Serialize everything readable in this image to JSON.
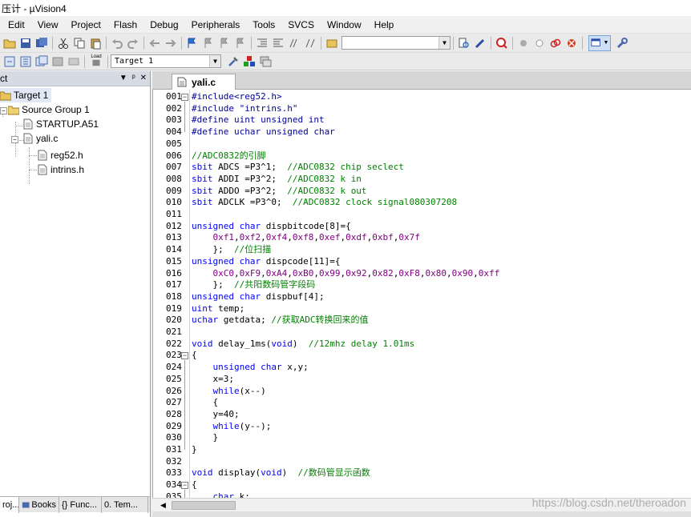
{
  "window": {
    "title": "压计 - µVision4"
  },
  "menu": [
    "Edit",
    "View",
    "Project",
    "Flash",
    "Debug",
    "Peripherals",
    "Tools",
    "SVCS",
    "Window",
    "Help"
  ],
  "toolbar": {
    "target_combo": "Target 1",
    "load_label": "Load"
  },
  "project_panel": {
    "header": "ct",
    "tree": {
      "target": "Target 1",
      "group": "Source Group 1",
      "files": [
        "STARTUP.A51",
        "yali.c"
      ],
      "includes": [
        "reg52.h",
        "intrins.h"
      ]
    },
    "tabs": [
      "roj...",
      "Books",
      "{} Func...",
      "0. Tem..."
    ]
  },
  "editor": {
    "tab_label": "yali.c",
    "line_numbers": [
      "001",
      "002",
      "003",
      "004",
      "005",
      "006",
      "007",
      "008",
      "009",
      "010",
      "011",
      "012",
      "013",
      "014",
      "015",
      "016",
      "017",
      "018",
      "019",
      "020",
      "021",
      "022",
      "023",
      "024",
      "025",
      "026",
      "027",
      "028",
      "029",
      "030",
      "031",
      "032",
      "033",
      "034",
      "035"
    ],
    "lines": [
      "#include<reg52.h>",
      "#include \"intrins.h\"",
      "#define uint unsigned int",
      "#define uchar unsigned char",
      "",
      "//ADC0832的引脚",
      "sbit ADCS =P3^1;  //ADC0832 chip seclect",
      "sbit ADDI =P3^2;  //ADC0832 k in",
      "sbit ADDO =P3^2;  //ADC0832 k out",
      "sbit ADCLK =P3^0;  //ADC0832 clock signal080307208",
      "",
      "unsigned char dispbitcode[8]={",
      "    0xf1,0xf2,0xf4,0xf8,0xef,0xdf,0xbf,0x7f",
      "    };  //位扫描",
      "unsigned char dispcode[11]={",
      "    0xC0,0xF9,0xA4,0xB0,0x99,0x92,0x82,0xF8,0x80,0x90,0xff",
      "    };  //共阳数码管字段码",
      "unsigned char dispbuf[4];",
      "uint temp;",
      "uchar getdata; //获取ADC转换回来的值",
      "",
      "void delay_1ms(void)  //12mhz delay 1.01ms",
      "{",
      "    unsigned char x,y;",
      "    x=3;",
      "    while(x--)",
      "    {",
      "    y=40;",
      "    while(y--);",
      "    }",
      "}",
      "",
      "void display(void)  //数码管显示函数",
      "{",
      "    char k;"
    ]
  },
  "watermark": "https://blog.csdn.net/theroadon"
}
